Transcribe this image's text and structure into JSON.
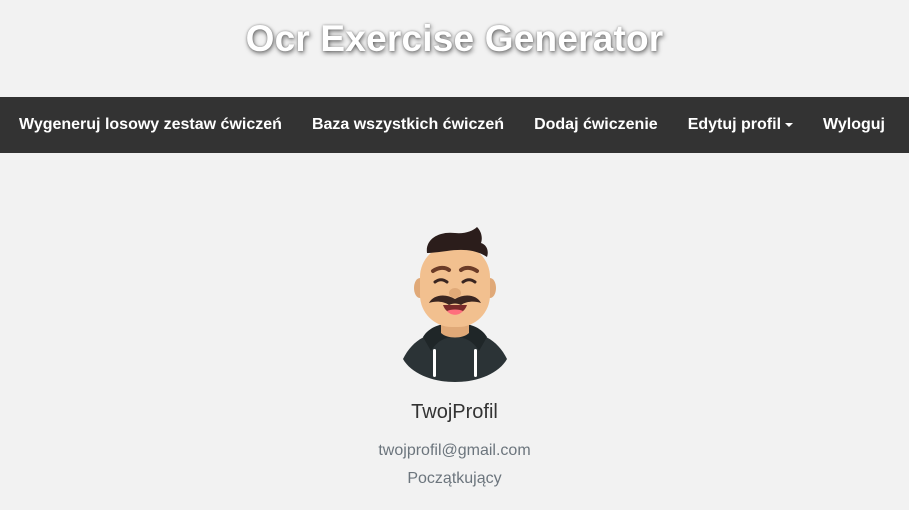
{
  "header": {
    "title": "Ocr Exercise Generator"
  },
  "nav": {
    "items": [
      {
        "label": "Wygeneruj losowy zestaw ćwiczeń"
      },
      {
        "label": "Baza wszystkich ćwiczeń"
      },
      {
        "label": "Dodaj ćwiczenie"
      },
      {
        "label": "Edytuj profil"
      },
      {
        "label": "Wyloguj"
      }
    ]
  },
  "profile": {
    "name": "TwojProfil",
    "email": "twojprofil@gmail.com",
    "level": "Początkujący"
  },
  "colors": {
    "navbar_bg": "#333333",
    "page_bg": "#f2f2f2",
    "muted_text": "#6c757d"
  },
  "icons": {
    "avatar": "avatar-icon",
    "dropdown": "caret-down-icon"
  }
}
